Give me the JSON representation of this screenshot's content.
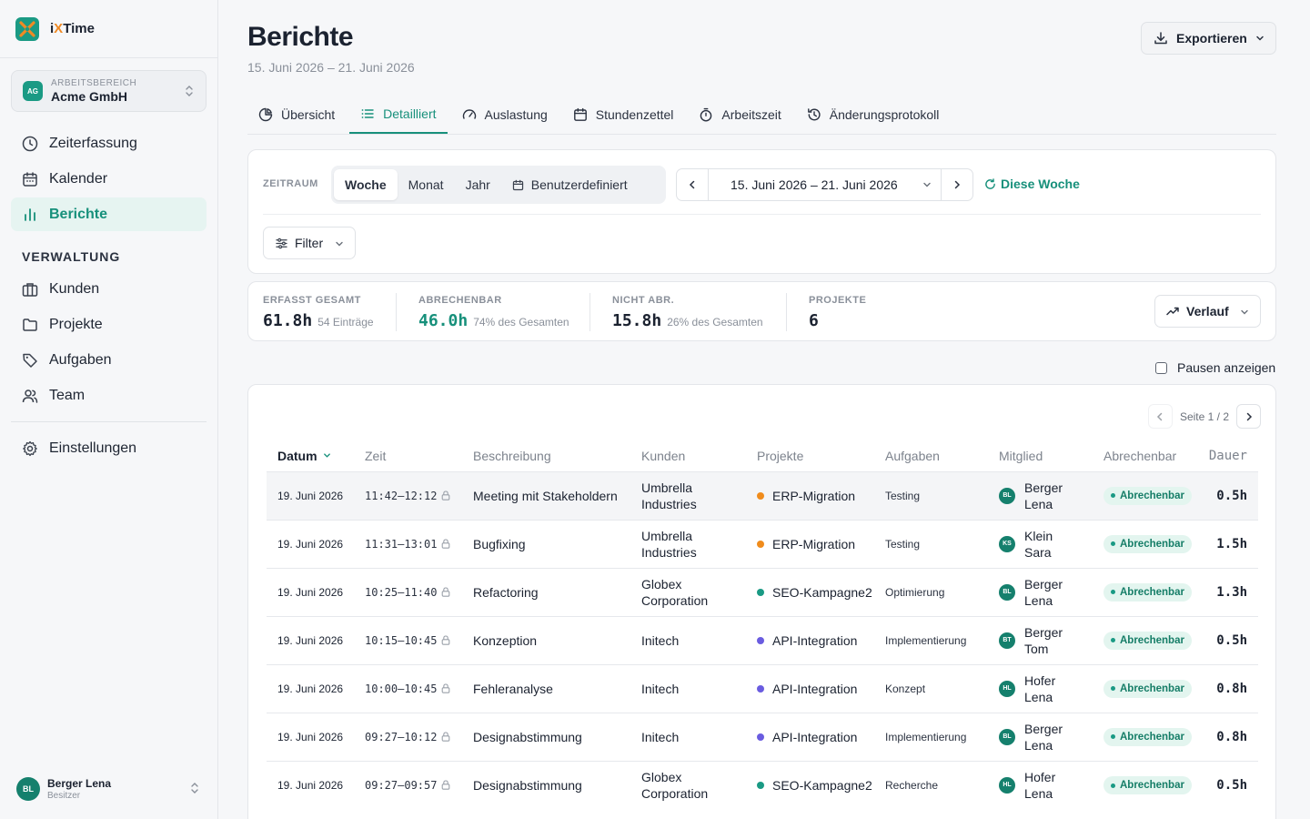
{
  "app": {
    "name_prefix": "i",
    "name_x": "X",
    "name_suffix": "Time"
  },
  "workspace": {
    "label": "ARBEITSBEREICH",
    "name": "Acme GmbH",
    "initials": "AG"
  },
  "nav": {
    "items": [
      {
        "label": "Zeiterfassung",
        "icon": "clock-icon"
      },
      {
        "label": "Kalender",
        "icon": "calendar-icon"
      },
      {
        "label": "Berichte",
        "icon": "bar-chart-icon",
        "active": true
      }
    ],
    "section_heading": "VERWALTUNG",
    "admin_items": [
      {
        "label": "Kunden",
        "icon": "briefcase-icon"
      },
      {
        "label": "Projekte",
        "icon": "folder-icon"
      },
      {
        "label": "Aufgaben",
        "icon": "tag-icon"
      },
      {
        "label": "Team",
        "icon": "users-icon"
      }
    ],
    "settings_label": "Einstellungen"
  },
  "user": {
    "name": "Berger Lena",
    "role": "Besitzer",
    "initials": "BL"
  },
  "header": {
    "title": "Berichte",
    "subtitle": "15. Juni 2026 – 21. Juni 2026",
    "export_label": "Exportieren"
  },
  "tabs": [
    {
      "label": "Übersicht",
      "icon": "pie-chart-icon"
    },
    {
      "label": "Detailliert",
      "icon": "list-icon",
      "active": true
    },
    {
      "label": "Auslastung",
      "icon": "gauge-icon"
    },
    {
      "label": "Stundenzettel",
      "icon": "calendar-icon"
    },
    {
      "label": "Arbeitszeit",
      "icon": "stopwatch-icon"
    },
    {
      "label": "Änderungsprotokoll",
      "icon": "history-icon"
    }
  ],
  "filters": {
    "period_label": "ZEITRAUM",
    "periods": [
      "Woche",
      "Monat",
      "Jahr",
      "Benutzerdefiniert"
    ],
    "active_period": "Woche",
    "range": "15. Juni 2026 – 21. Juni 2026",
    "this_week": "Diese Woche",
    "filter_label": "Filter"
  },
  "stats": {
    "total": {
      "label": "ERFASST GESAMT",
      "value": "61.8h",
      "sub": "54 Einträge"
    },
    "billable": {
      "label": "ABRECHENBAR",
      "value": "46.0h",
      "sub": "74% des Gesamten"
    },
    "non_billable": {
      "label": "NICHT ABR.",
      "value": "15.8h",
      "sub": "26% des Gesamten"
    },
    "projects": {
      "label": "PROJEKTE",
      "value": "6"
    },
    "trend_label": "Verlauf"
  },
  "show_breaks_label": "Pausen anzeigen",
  "pager": {
    "text": "Seite 1 / 2"
  },
  "table": {
    "columns": [
      "Datum",
      "Zeit",
      "Beschreibung",
      "Kunden",
      "Projekte",
      "Aufgaben",
      "Mitglied",
      "Abrechenbar",
      "Dauer"
    ],
    "rows": [
      {
        "date": "19. Juni 2026",
        "time": "11:42–12:12",
        "desc": "Meeting mit Stakeholdern",
        "client": "Umbrella Industries",
        "project": "ERP-Migration",
        "project_color": "#f08c1c",
        "task": "Testing",
        "member": "Berger Lena",
        "initials": "BL",
        "billable": "Abrechenbar",
        "duration": "0.5h"
      },
      {
        "date": "19. Juni 2026",
        "time": "11:31–13:01",
        "desc": "Bugfixing",
        "client": "Umbrella Industries",
        "project": "ERP-Migration",
        "project_color": "#f08c1c",
        "task": "Testing",
        "member": "Klein Sara",
        "initials": "KS",
        "billable": "Abrechenbar",
        "duration": "1.5h"
      },
      {
        "date": "19. Juni 2026",
        "time": "10:25–11:40",
        "desc": "Refactoring",
        "client": "Globex Corporation",
        "project": "SEO-Kampagne2",
        "project_color": "#1a9a84",
        "task": "Optimierung",
        "member": "Berger Lena",
        "initials": "BL",
        "billable": "Abrechenbar",
        "duration": "1.3h"
      },
      {
        "date": "19. Juni 2026",
        "time": "10:15–10:45",
        "desc": "Konzeption",
        "client": "Initech",
        "project": "API-Integration",
        "project_color": "#6a5ce0",
        "task": "Implementierung",
        "member": "Berger Tom",
        "initials": "BT",
        "billable": "Abrechenbar",
        "duration": "0.5h"
      },
      {
        "date": "19. Juni 2026",
        "time": "10:00–10:45",
        "desc": "Fehleranalyse",
        "client": "Initech",
        "project": "API-Integration",
        "project_color": "#6a5ce0",
        "task": "Konzept",
        "member": "Hofer Lena",
        "initials": "HL",
        "billable": "Abrechenbar",
        "duration": "0.8h"
      },
      {
        "date": "19. Juni 2026",
        "time": "09:27–10:12",
        "desc": "Designabstimmung",
        "client": "Initech",
        "project": "API-Integration",
        "project_color": "#6a5ce0",
        "task": "Implementierung",
        "member": "Berger Lena",
        "initials": "BL",
        "billable": "Abrechenbar",
        "duration": "0.8h"
      },
      {
        "date": "19. Juni 2026",
        "time": "09:27–09:57",
        "desc": "Designabstimmung",
        "client": "Globex Corporation",
        "project": "SEO-Kampagne2",
        "project_color": "#1a9a84",
        "task": "Recherche",
        "member": "Hofer Lena",
        "initials": "HL",
        "billable": "Abrechenbar",
        "duration": "0.5h"
      }
    ]
  },
  "colors": {
    "accent": "#17907b",
    "brand": "#1a9a84"
  }
}
